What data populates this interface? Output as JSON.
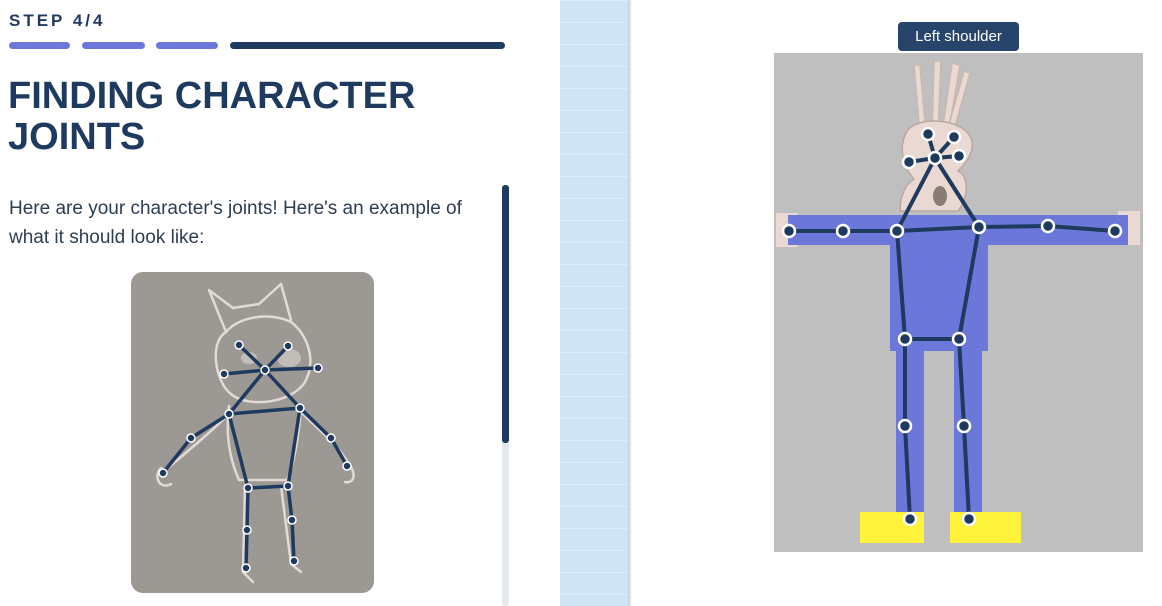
{
  "step": {
    "label": "STEP 4/4",
    "current": 4,
    "total": 4
  },
  "heading": "FINDING CHARACTER JOINTS",
  "description": "Here are your character's joints! Here's an example of what it should look like:",
  "tooltip": {
    "label": "Left shoulder"
  },
  "colors": {
    "accent": "#6b78d9",
    "navy": "#1e3a5f",
    "joint_fill": "#1e3a5f",
    "body_blue": "#6b78d9",
    "shoe_yellow": "#fff23a",
    "canvas_bg": "#bfbfbf",
    "example_bg": "#9c9893",
    "divider_blue": "#cfe4f4"
  },
  "icons": [
    "joint-point-icon"
  ]
}
